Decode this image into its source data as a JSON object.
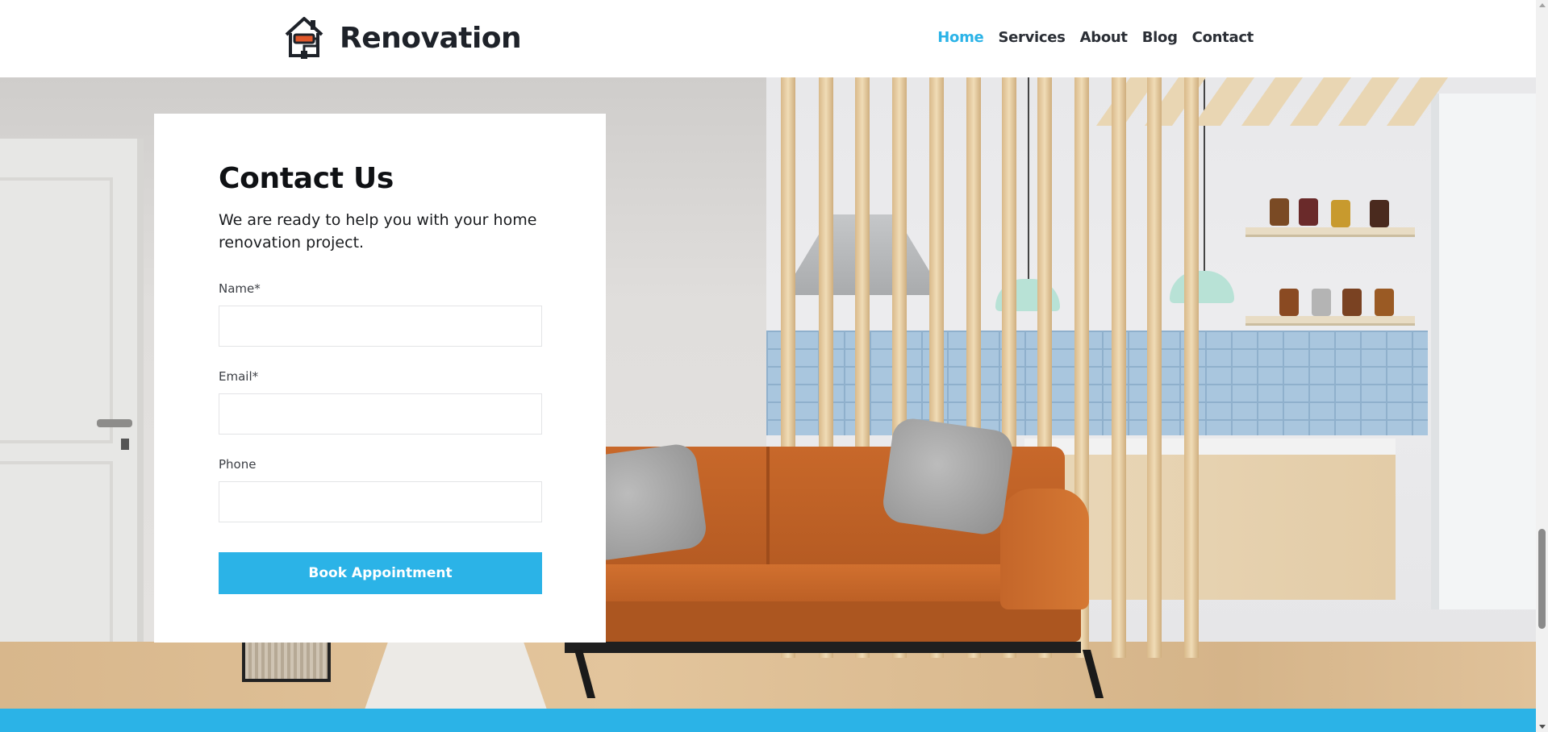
{
  "header": {
    "logo_text": "Renovation",
    "logo_icon": "house-paint-roller-icon",
    "nav": [
      {
        "label": "Home",
        "active": true
      },
      {
        "label": "Services",
        "active": false
      },
      {
        "label": "About",
        "active": false
      },
      {
        "label": "Blog",
        "active": false
      },
      {
        "label": "Contact",
        "active": false
      }
    ]
  },
  "contact": {
    "title": "Contact Us",
    "subtitle": "We are ready to help you with your home renovation project.",
    "fields": [
      {
        "label": "Name*",
        "value": "",
        "placeholder": ""
      },
      {
        "label": "Email*",
        "value": "",
        "placeholder": ""
      },
      {
        "label": "Phone",
        "value": "",
        "placeholder": ""
      }
    ],
    "submit_label": "Book Appointment"
  },
  "colors": {
    "accent": "#2bb3e7",
    "text_dark": "#1e2229",
    "sofa": "#c8682a"
  },
  "scroll": {
    "position_fraction": 0.9
  }
}
